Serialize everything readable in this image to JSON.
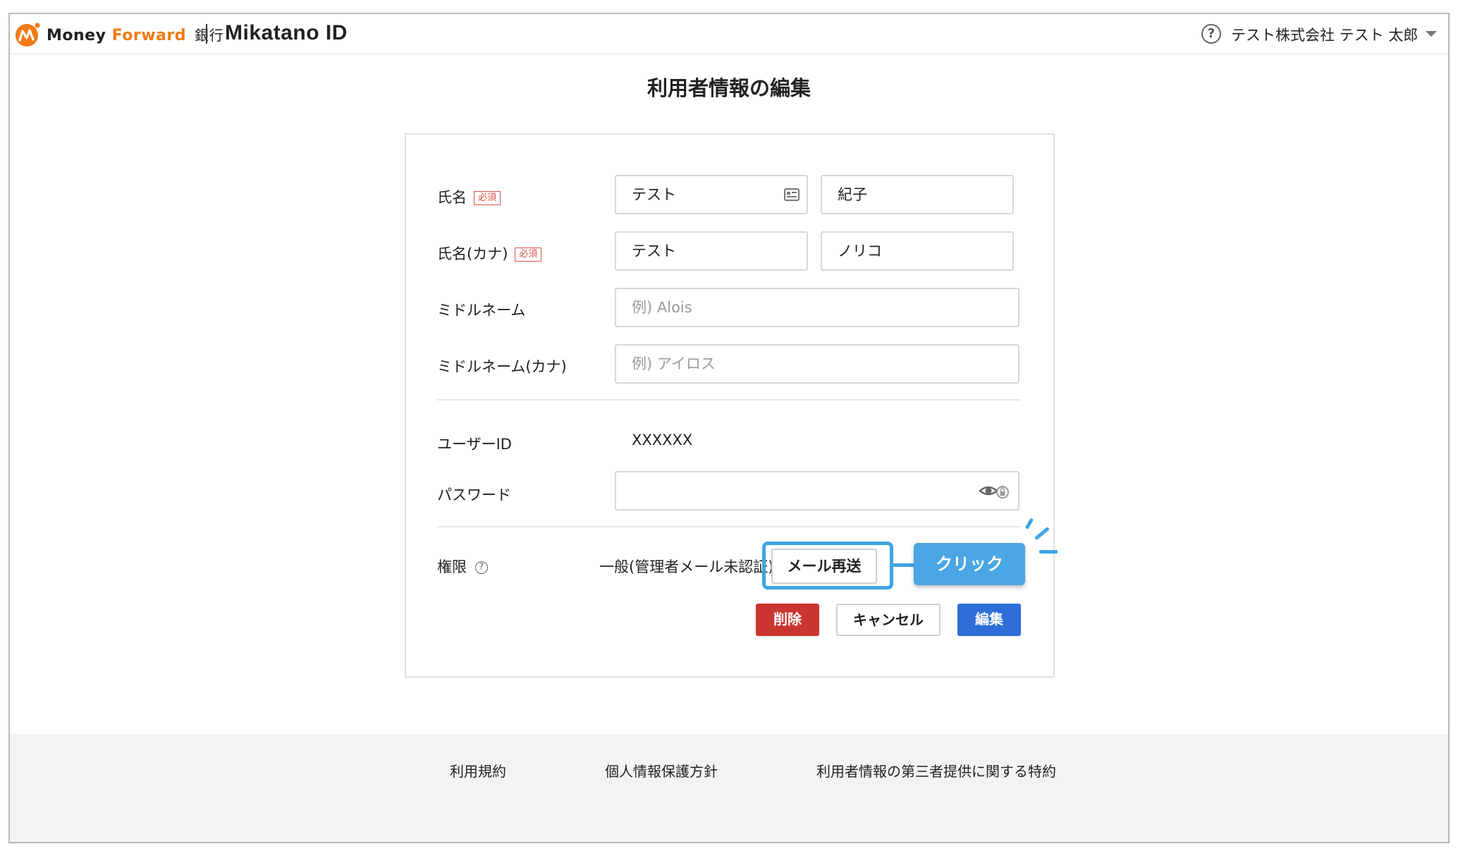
{
  "header": {
    "brand_money": "Money",
    "brand_forward": "Forward",
    "brand_bank": "銀行",
    "brand_id": "Mikatano ID",
    "help_symbol": "?",
    "user": "テスト株式会社  テスト 太郎"
  },
  "page": {
    "title": "利用者情報の編集"
  },
  "form": {
    "name_label": "氏名",
    "name_kana_label": "氏名(カナ)",
    "required_badge": "必須",
    "last_name": "テスト",
    "first_name": "紀子",
    "last_name_kana": "テスト",
    "first_name_kana": "ノリコ",
    "middle_name_label": "ミドルネーム",
    "middle_name_placeholder": "例) Alois",
    "middle_name_kana_label": "ミドルネーム(カナ)",
    "middle_name_kana_placeholder": "例) アイロス",
    "user_id_label": "ユーザーID",
    "user_id_value": "XXXXXX",
    "password_label": "パスワード",
    "role_label": "権限",
    "role_help_symbol": "?",
    "role_value": "一般(管理者メール未認証)",
    "resend_button": "メール再送"
  },
  "annotation": {
    "click_label": "クリック"
  },
  "actions": {
    "delete": "削除",
    "cancel": "キャンセル",
    "edit": "編集"
  },
  "footer": {
    "terms": "利用規約",
    "privacy": "個人情報保護方針",
    "third_party": "利用者情報の第三者提供に関する特約"
  },
  "colors": {
    "brand_orange": "#f07b15",
    "highlight_blue": "#3fa4e0",
    "delete_red": "#c9362f",
    "edit_blue": "#2f6ed8",
    "required_red": "#d9534f"
  }
}
